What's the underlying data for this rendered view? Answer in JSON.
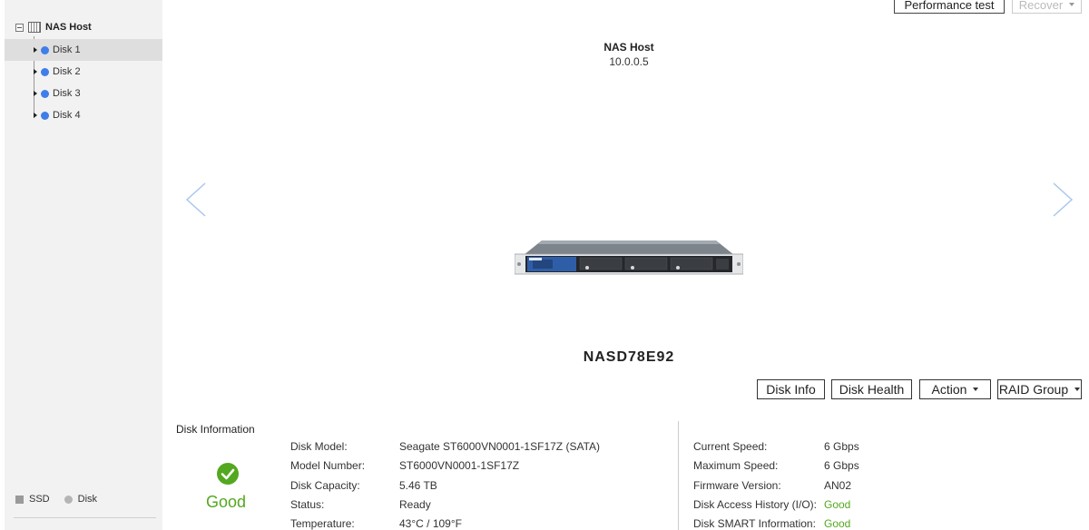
{
  "sidebar": {
    "root_label": "NAS Host",
    "items": [
      {
        "label": "Disk 1",
        "selected": true
      },
      {
        "label": "Disk 2",
        "selected": false
      },
      {
        "label": "Disk 3",
        "selected": false
      },
      {
        "label": "Disk 4",
        "selected": false
      }
    ],
    "legend": {
      "ssd_label": "SSD",
      "disk_label": "Disk"
    }
  },
  "toolbar": {
    "performance_test_label": "Performance test",
    "recover_label": "Recover"
  },
  "host": {
    "name": "NAS Host",
    "ip": "10.0.0.5"
  },
  "device": {
    "name": "NASD78E92"
  },
  "actions": {
    "disk_info": "Disk Info",
    "disk_health": "Disk Health",
    "action": "Action",
    "raid_group": "RAID Group"
  },
  "disk_info": {
    "title": "Disk Information",
    "status_text": "Good",
    "left_fields": [
      {
        "label": "Disk Model:",
        "value": "Seagate ST6000VN0001-1SF17Z (SATA)"
      },
      {
        "label": "Model Number:",
        "value": "ST6000VN0001-1SF17Z"
      },
      {
        "label": "Disk Capacity:",
        "value": "5.46 TB"
      },
      {
        "label": "Status:",
        "value": "Ready"
      },
      {
        "label": "Temperature:",
        "value": "43°C / 109°F"
      }
    ],
    "right_fields": [
      {
        "label": "Current Speed:",
        "value": "6 Gbps"
      },
      {
        "label": "Maximum Speed:",
        "value": "6 Gbps"
      },
      {
        "label": "Firmware Version:",
        "value": "AN02"
      },
      {
        "label": "Disk Access History (I/O):",
        "value": "Good"
      },
      {
        "label": "Disk SMART Information:",
        "value": "Good"
      }
    ]
  },
  "colors": {
    "accent_blue": "#3f7ee8",
    "good_green": "#54a820",
    "sidebar_bg": "#f2f2f2",
    "selected_bg": "#dedede"
  },
  "icons": [
    "tree-collapse-icon",
    "nas-host-icon",
    "disk-status-dot-icon",
    "prev-arrow-icon",
    "next-arrow-icon",
    "good-check-icon"
  ]
}
